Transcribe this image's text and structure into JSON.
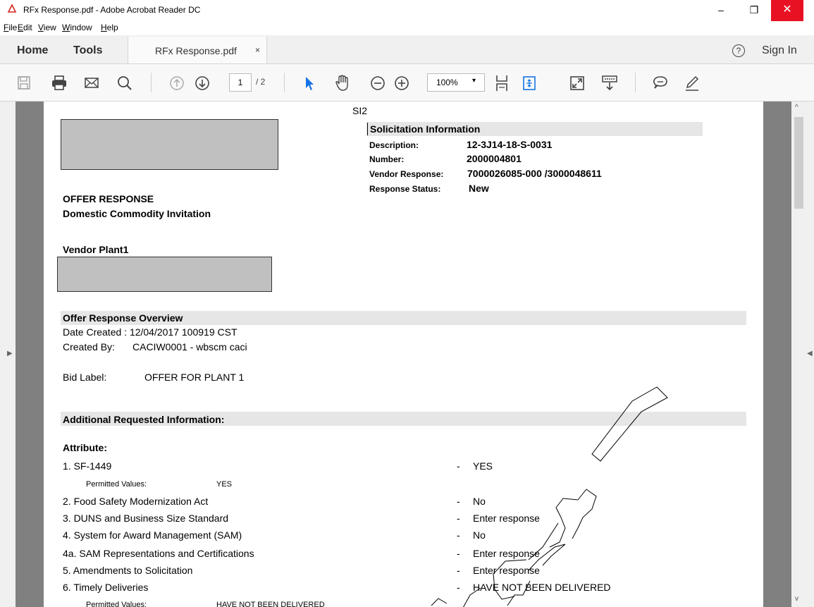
{
  "window": {
    "title": "RFx Response.pdf - Adobe Acrobat Reader DC",
    "minimize": "–",
    "maximize": "❐",
    "close": "✕"
  },
  "menu": [
    "File",
    "Edit",
    "View",
    "Window",
    "Help"
  ],
  "tabs": {
    "home": "Home",
    "tools": "Tools",
    "document": "RFx Response.pdf",
    "close": "×",
    "help": "?",
    "signin": "Sign In"
  },
  "toolbar": {
    "page_current": "1",
    "page_total": "/ 2",
    "zoom": "100%",
    "icons": [
      "save-icon",
      "print-icon",
      "email-icon",
      "search-icon",
      "page-up-icon",
      "page-down-icon",
      "select-cursor-icon",
      "hand-icon",
      "zoom-out-icon",
      "zoom-in-icon",
      "fit-page-icon",
      "rotate-icon",
      "fullscreen-icon",
      "keyboard-icon",
      "comment-icon",
      "sign-pen-icon"
    ]
  },
  "document": {
    "code": "SI2",
    "solicitation": {
      "heading": "Solicitation Information",
      "desc_label": "Description:",
      "desc_value": "12-3J14-18-S-0031",
      "number_label": "Number:",
      "number_value": "2000004801",
      "vendor_label": "Vendor Response:",
      "vendor_value": "7000026085-000 /3000048611",
      "status_label": "Response Status:",
      "status_value": "New"
    },
    "offer_title": "OFFER RESPONSE",
    "offer_subtitle": "Domestic Commodity Invitation",
    "vendor_plant": "Vendor Plant1",
    "overview": {
      "heading": "Offer Response Overview",
      "date_created": "Date Created : 12/04/2017 100919 CST",
      "created_by_label": "Created By:",
      "created_by_value": "CACIW0001 - wbscm caci",
      "bid_label": "Bid Label:",
      "bid_value": "OFFER FOR PLANT 1"
    },
    "additional_heading": "Additional Requested Information:",
    "attribute_heading": "Attribute:",
    "attributes": [
      {
        "name": "1. SF-1449",
        "dash": "-",
        "response": "YES"
      },
      {
        "name": "Permitted Values:",
        "dash": "",
        "response": "YES"
      },
      {
        "name": "2. Food Safety Modernization Act",
        "dash": "-",
        "response": "No"
      },
      {
        "name": "3. DUNS and Business Size Standard",
        "dash": "-",
        "response": "Enter response"
      },
      {
        "name": "4. System for Award Management (SAM)",
        "dash": "-",
        "response": "No"
      },
      {
        "name": "4a. SAM Representations and Certifications",
        "dash": "-",
        "response": "Enter response"
      },
      {
        "name": "5. Amendments to Solicitation",
        "dash": "-",
        "response": "Enter response"
      },
      {
        "name": "6. Timely Deliveries",
        "dash": "-",
        "response": "HAVE NOT BEEN DELIVERED"
      },
      {
        "name": "Permitted Values:",
        "dash": "",
        "response": "HAVE NOT BEEN DELIVERED"
      }
    ]
  },
  "colors": {
    "close_button": "#e81123",
    "accent_blue": "#1473e6",
    "page_gray": "#808080",
    "redaction": "#c0c0c0",
    "section_shade": "#e6e6e6"
  }
}
